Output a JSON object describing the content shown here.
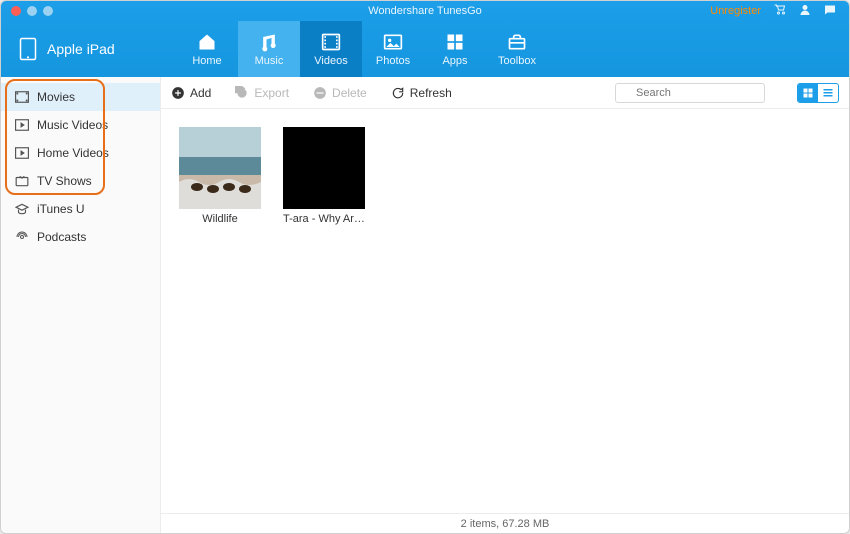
{
  "window": {
    "title": "Wondershare TunesGo",
    "unregister": "Unregister"
  },
  "device": {
    "name": "Apple iPad"
  },
  "nav": {
    "home": "Home",
    "music": "Music",
    "videos": "Videos",
    "photos": "Photos",
    "apps": "Apps",
    "toolbox": "Toolbox"
  },
  "sidebar": {
    "items": [
      {
        "label": "Movies"
      },
      {
        "label": "Music Videos"
      },
      {
        "label": "Home Videos"
      },
      {
        "label": "TV Shows"
      },
      {
        "label": "iTunes U"
      },
      {
        "label": "Podcasts"
      }
    ]
  },
  "toolbar": {
    "add": "Add",
    "export": "Export",
    "delete": "Delete",
    "refresh": "Refresh",
    "search_placeholder": "Search"
  },
  "items": [
    {
      "title": "Wildlife"
    },
    {
      "title": "T-ara - Why Are…"
    }
  ],
  "status": "2 items, 67.28 MB"
}
